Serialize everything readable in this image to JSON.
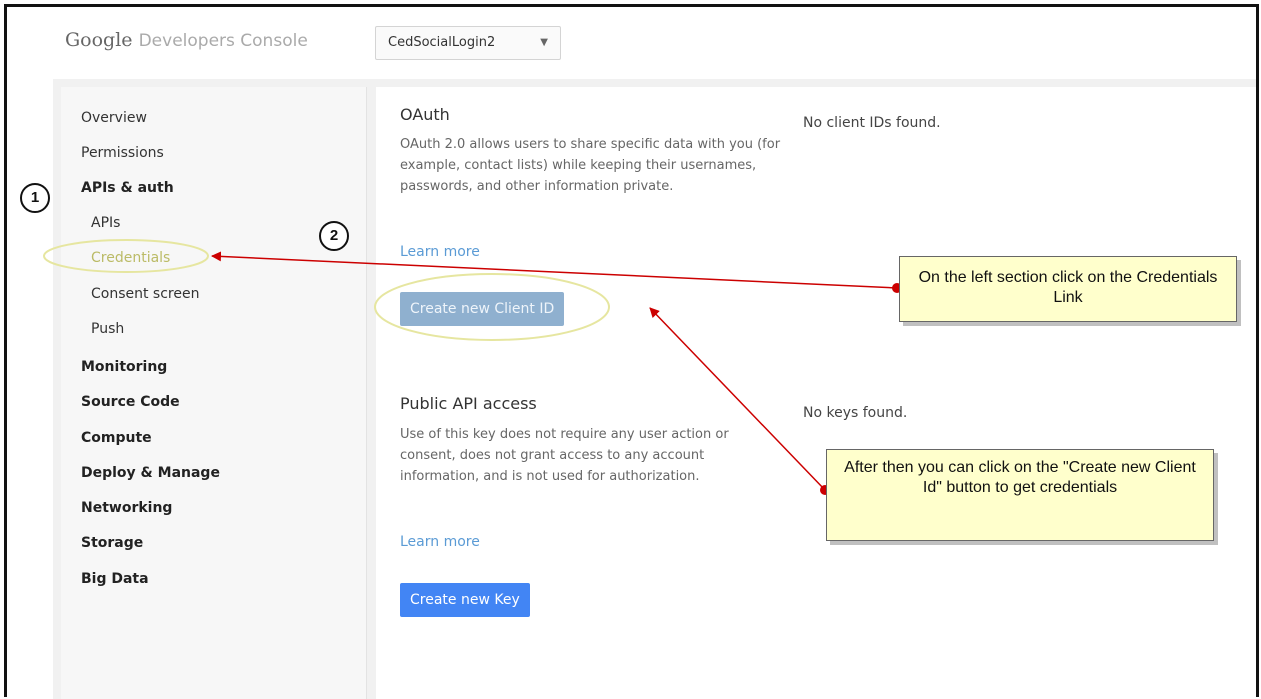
{
  "header": {
    "logo_brand": "Google",
    "logo_product": "Developers Console",
    "project_name": "CedSocialLogin2"
  },
  "sidebar": {
    "items": [
      {
        "label": "Overview"
      },
      {
        "label": "Permissions"
      },
      {
        "label": "APIs & auth"
      },
      {
        "label": "APIs"
      },
      {
        "label": "Credentials"
      },
      {
        "label": "Consent screen"
      },
      {
        "label": "Push"
      },
      {
        "label": "Monitoring"
      },
      {
        "label": "Source Code"
      },
      {
        "label": "Compute"
      },
      {
        "label": "Deploy & Manage"
      },
      {
        "label": "Networking"
      },
      {
        "label": "Storage"
      },
      {
        "label": "Big Data"
      }
    ]
  },
  "oauth": {
    "title": "OAuth",
    "description": "OAuth 2.0 allows users to share specific data with you (for example, contact lists) while keeping their usernames, passwords, and other information private.",
    "learn_more": "Learn more",
    "button_label": "Create new Client ID",
    "empty_text": "No client IDs found."
  },
  "public_api": {
    "title": "Public API access",
    "description": "Use of this key does not require any user action or consent, does not grant access to any account information, and is not used for authorization.",
    "learn_more": "Learn more",
    "button_label": "Create new Key",
    "empty_text": "No keys found."
  },
  "annotations": {
    "marker_1": "1",
    "marker_2": "2",
    "callout_1": "On the left section click on the Credentials Link",
    "callout_2": "After then you can click on the \"Create new Client Id\" button to get credentials"
  },
  "colors": {
    "accent_blue": "#4285f4",
    "link_blue": "#5b9bd5",
    "annotation_red": "#cc0000",
    "callout_yellow": "#ffffcc",
    "highlight_ellipse": "#ffffdd"
  }
}
